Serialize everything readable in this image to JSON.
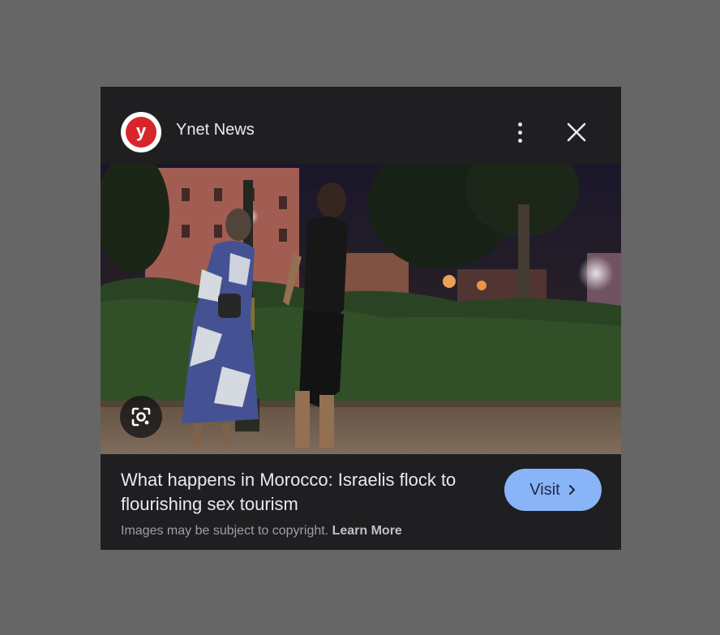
{
  "source": {
    "logo_letter": "y",
    "name": "Ynet News"
  },
  "header": {
    "menu_icon": "more-vert-icon",
    "close_icon": "close-icon"
  },
  "image": {
    "lens_icon": "lens-icon"
  },
  "headline": "What happens in Morocco: Israelis flock to flourishing sex tourism",
  "visit_button": {
    "label": "Visit",
    "icon": "chevron-right-icon"
  },
  "footer": {
    "copyright_text": "Images may be subject to copyright.",
    "learn_more": "Learn More"
  },
  "colors": {
    "page_bg": "#666666",
    "card_bg": "#1f1f21",
    "accent": "#8ab4f8",
    "logo_red": "#d7262b"
  }
}
